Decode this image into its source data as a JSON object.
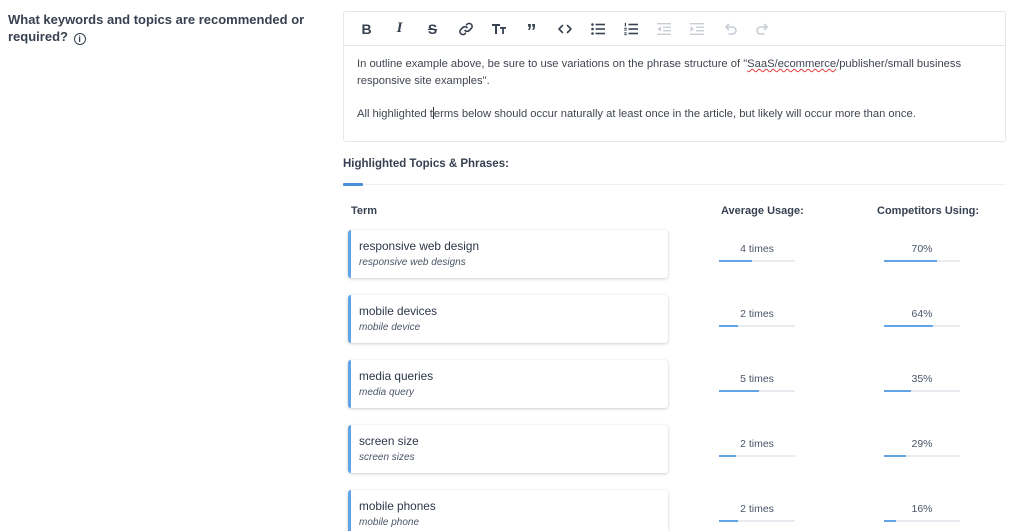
{
  "question": {
    "label": "What keywords and topics are recommended or required?",
    "info_icon": "info-circle-icon"
  },
  "editor": {
    "toolbar": [
      {
        "name": "bold-button",
        "icon": "bold-icon",
        "glyph": "B",
        "enabled": true
      },
      {
        "name": "italic-button",
        "icon": "italic-icon",
        "glyph": "I",
        "enabled": true
      },
      {
        "name": "strikethrough-button",
        "icon": "strikethrough-icon",
        "glyph": "S",
        "enabled": true
      },
      {
        "name": "link-button",
        "icon": "link-icon",
        "glyph": "link",
        "enabled": true
      },
      {
        "name": "heading-button",
        "icon": "text-size-icon",
        "glyph": "TT",
        "enabled": true
      },
      {
        "name": "blockquote-button",
        "icon": "quote-icon",
        "glyph": "❞",
        "enabled": true
      },
      {
        "name": "code-button",
        "icon": "code-icon",
        "glyph": "<>",
        "enabled": true
      },
      {
        "name": "bullet-list-button",
        "icon": "bullet-list-icon",
        "glyph": "ul",
        "enabled": true
      },
      {
        "name": "numbered-list-button",
        "icon": "numbered-list-icon",
        "glyph": "ol",
        "enabled": true
      },
      {
        "name": "outdent-button",
        "icon": "outdent-icon",
        "glyph": "out",
        "enabled": false
      },
      {
        "name": "indent-button",
        "icon": "indent-icon",
        "glyph": "in",
        "enabled": false
      },
      {
        "name": "undo-button",
        "icon": "undo-icon",
        "glyph": "↶",
        "enabled": false
      },
      {
        "name": "redo-button",
        "icon": "redo-icon",
        "glyph": "↷",
        "enabled": false
      }
    ],
    "paragraph1_before": "In outline example above, be sure to use variations on the phrase structure of \"",
    "paragraph1_squiggle": "SaaS/ecommerce",
    "paragraph1_after": "/publisher/small business responsive site examples\".",
    "paragraph2_before": "All highlighted t",
    "paragraph2_after": "erms below should occur naturally at least once in the article, but likely will occur more than once."
  },
  "highlighted": {
    "title": "Highlighted Topics & Phrases:",
    "columns": {
      "term": "Term",
      "usage": "Average Usage:",
      "competitors": "Competitors Using:"
    },
    "rows": [
      {
        "term": "responsive web design",
        "variant": "responsive web designs",
        "usage": "4 times",
        "usage_fill": 0.43,
        "competitors": "70%",
        "competitors_fill": 0.7
      },
      {
        "term": "mobile devices",
        "variant": "mobile device",
        "usage": "2 times",
        "usage_fill": 0.25,
        "competitors": "64%",
        "competitors_fill": 0.64
      },
      {
        "term": "media queries",
        "variant": "media query",
        "usage": "5 times",
        "usage_fill": 0.52,
        "competitors": "35%",
        "competitors_fill": 0.35
      },
      {
        "term": "screen size",
        "variant": "screen sizes",
        "usage": "2 times",
        "usage_fill": 0.22,
        "competitors": "29%",
        "competitors_fill": 0.29
      },
      {
        "term": "mobile phones",
        "variant": "mobile phone",
        "usage": "2 times",
        "usage_fill": 0.25,
        "competitors": "16%",
        "competitors_fill": 0.16
      }
    ]
  },
  "colors": {
    "accent": "#63a4e8",
    "text": "#374151",
    "border": "#e5e7eb"
  }
}
